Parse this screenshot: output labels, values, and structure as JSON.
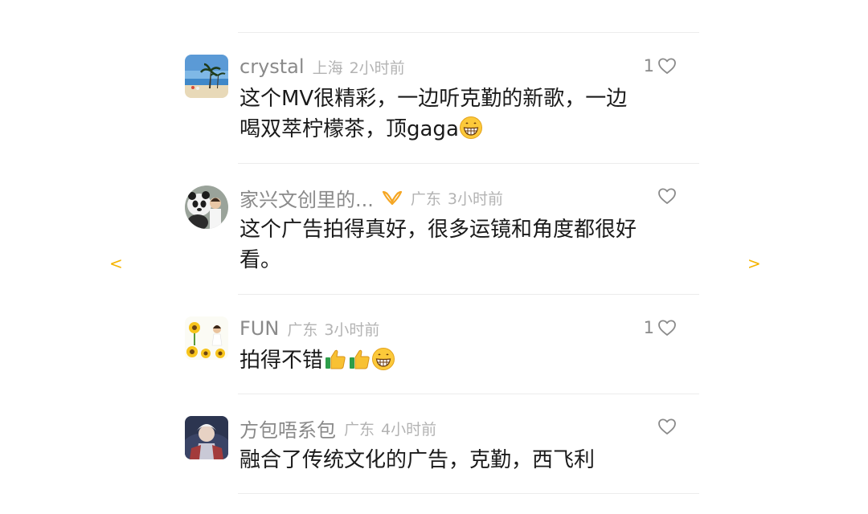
{
  "navigation": {
    "prev_label": "<",
    "next_label": ">"
  },
  "comments": [
    {
      "username": "crystal",
      "location": "上海",
      "time": "2小时前",
      "likes": "1",
      "text_line1": "这个MV很精彩，一边听克勤的新歌，一边",
      "text_line2": "喝双萃柠檬茶，顶gaga"
    },
    {
      "username": "家兴文创里的...",
      "location": "广东",
      "time": "3小时前",
      "likes": "",
      "text_line1": "这个广告拍得真好，很多运镜和角度都很好",
      "text_line2": "看。"
    },
    {
      "username": "FUN",
      "location": "广东",
      "time": "3小时前",
      "likes": "1",
      "text_line1": "拍得不错"
    },
    {
      "username": "方包唔系包",
      "location": "广东",
      "time": "4小时前",
      "likes": "",
      "text_line1": "融合了传统文化的广告，克勤，西飞利"
    }
  ],
  "icons": [
    "heart-icon",
    "grin-emoji-icon",
    "thumbs-up-emoji-icon",
    "verified-badge-icon"
  ],
  "colors": {
    "accent": "#f5b400",
    "username": "#8a8a8a",
    "meta": "#b3b3b3",
    "text": "#1a1a1a",
    "divider": "#ececec"
  }
}
